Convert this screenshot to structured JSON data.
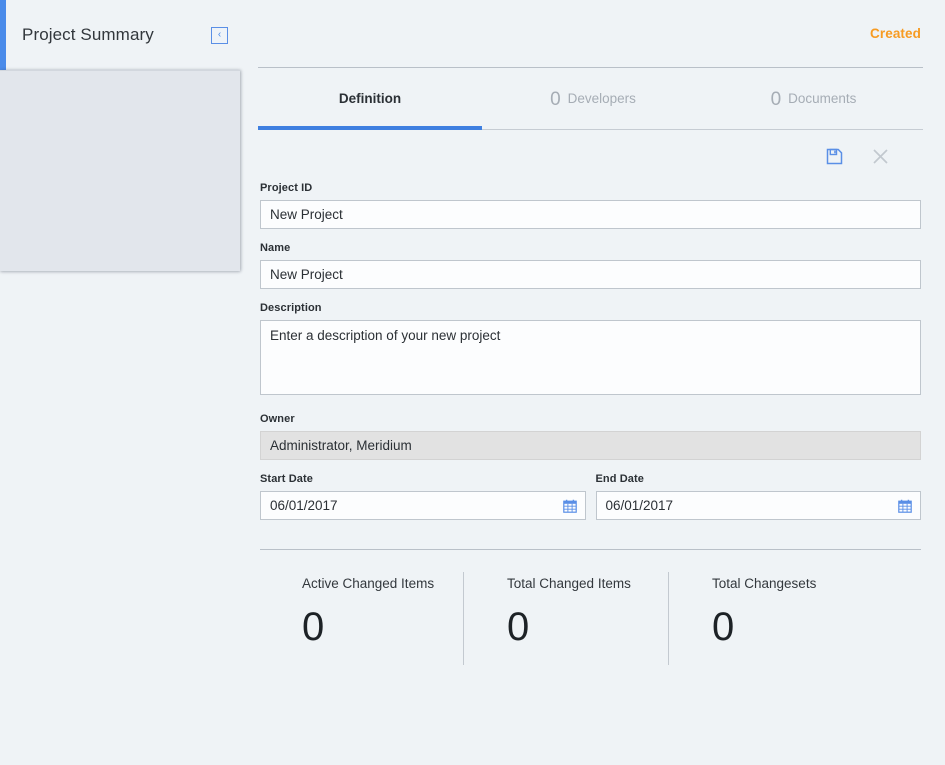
{
  "sidebar": {
    "title": "Project Summary",
    "collapse_icon": "chevron-left-icon",
    "collapse_glyph": "‹"
  },
  "header": {
    "status": "Created",
    "status_color": "#f79b22"
  },
  "tabs": [
    {
      "label": "Definition",
      "count": "",
      "active": true
    },
    {
      "label": "Developers",
      "count": "0",
      "active": false
    },
    {
      "label": "Documents",
      "count": "0",
      "active": false
    }
  ],
  "toolbar": {
    "save_icon": "save-icon",
    "save_label": "Save",
    "cancel_icon": "close-icon",
    "cancel_label": "Cancel"
  },
  "form": {
    "project_id": {
      "label": "Project ID",
      "value": "New Project",
      "placeholder": "Project ID"
    },
    "name": {
      "label": "Name",
      "value": "New Project",
      "placeholder": "Name"
    },
    "description": {
      "label": "Description",
      "value": "Enter a description of your new project",
      "placeholder": "Enter a description of your new project"
    },
    "owner": {
      "label": "Owner",
      "value": "Administrator, Meridium",
      "readonly": true
    },
    "start_date": {
      "label": "Start Date",
      "value": "06/01/2017",
      "icon": "calendar-icon"
    },
    "end_date": {
      "label": "End Date",
      "value": "06/01/2017",
      "icon": "calendar-icon"
    }
  },
  "stats": [
    {
      "label": "Active Changed Items",
      "value": "0"
    },
    {
      "label": "Total Changed Items",
      "value": "0"
    },
    {
      "label": "Total Changesets",
      "value": "0"
    }
  ],
  "colors": {
    "accent_blue": "#4a8bea",
    "tab_underline": "#3e7fe0",
    "status_orange": "#f79b22",
    "page_background": "#eff3f6"
  }
}
